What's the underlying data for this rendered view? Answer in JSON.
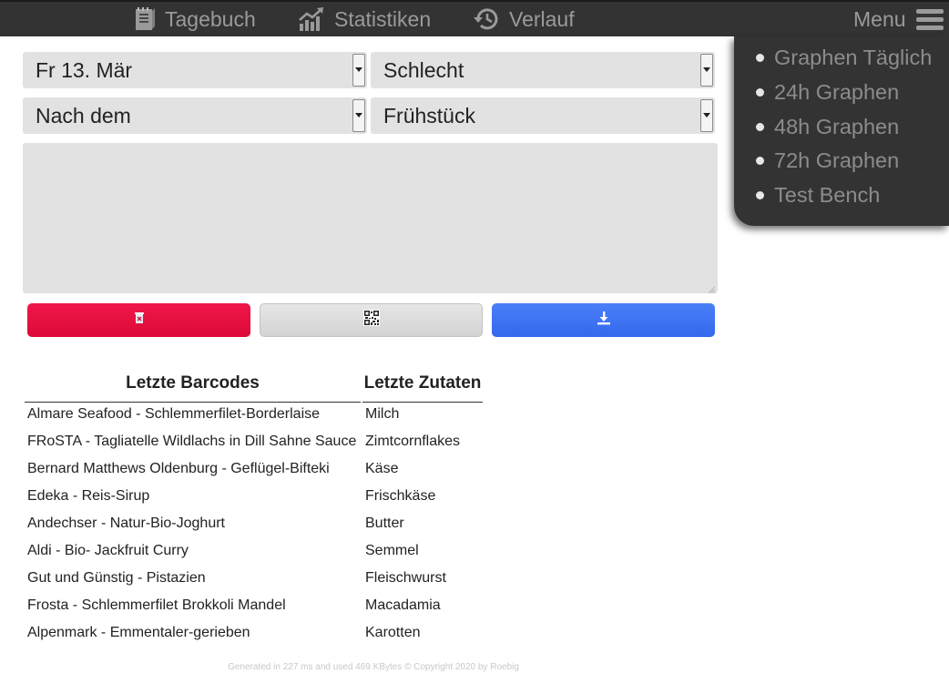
{
  "nav": {
    "tagebuch": "Tagebuch",
    "statistiken": "Statistiken",
    "verlauf": "Verlauf",
    "menu": "Menu"
  },
  "menu_items": [
    "Graphen Täglich",
    "24h Graphen",
    "48h Graphen",
    "72h Graphen",
    "Test Bench"
  ],
  "form": {
    "date": "Fr 13. Mär",
    "mood": "Schlecht",
    "when": "Nach dem",
    "meal": "Frühstück",
    "notes": ""
  },
  "buttons": {
    "delete_icon": "trash-icon",
    "qr_icon": "qr-code-icon",
    "save_icon": "download-icon"
  },
  "barcodes": {
    "header": "Letzte Barcodes",
    "items": [
      "Almare Seafood - Schlemmerfilet-Borderlaise",
      "FRoSTA - Tagliatelle Wildlachs in Dill Sahne Sauce",
      "Bernard Matthews Oldenburg - Geflügel-Bifteki",
      "Edeka - Reis-Sirup",
      "Andechser - Natur-Bio-Joghurt",
      "Aldi - Bio- Jackfruit Curry",
      "Gut und Günstig - Pistazien",
      "Frosta - Schlemmerfilet Brokkoli Mandel",
      "Alpenmark - Emmentaler-gerieben"
    ]
  },
  "zutaten": {
    "header": "Letzte Zutaten",
    "items": [
      "Milch",
      "Zimtcornflakes",
      "Käse",
      "Frischkäse",
      "Butter",
      "Semmel",
      "Fleischwurst",
      "Macadamia",
      "Karotten"
    ]
  },
  "footer": "Generated in 227 ms and used 469 KBytes © Copyright 2020 by Roebig",
  "colors": {
    "bar": "#333333",
    "delete": "#e8103f",
    "save": "#3d72f2",
    "field": "#e2e2e2"
  }
}
